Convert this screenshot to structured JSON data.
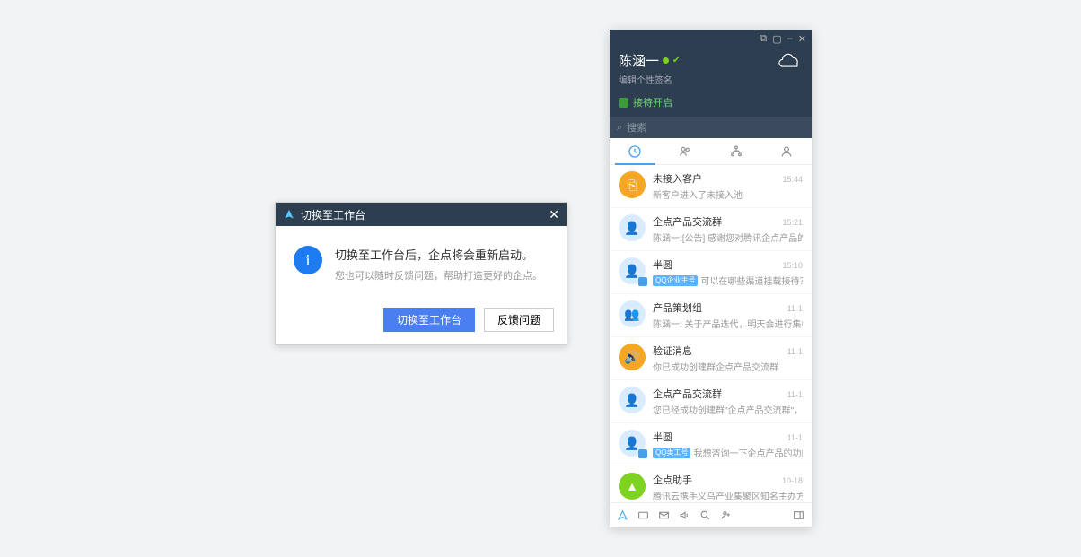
{
  "dialog": {
    "title": "切换至工作台",
    "message": "切换至工作台后，企点将会重新启动。",
    "sub": "您也可以随时反馈问题，帮助打造更好的企点。",
    "primary_btn": "切换至工作台",
    "secondary_btn": "反馈问题"
  },
  "window": {
    "username": "陈涵一",
    "signature": "编辑个性签名",
    "status_text": "接待开启",
    "search_placeholder": "搜索",
    "conversations": [
      {
        "avatar": "orange",
        "avatar_glyph": "⎘",
        "title": "未接入客户",
        "time": "15:44",
        "sub": "新客户进入了未接入池",
        "badge": ""
      },
      {
        "avatar": "blue",
        "avatar_glyph": "👤",
        "title": "企点产品交流群",
        "time": "15:21",
        "sub": "陈涵一:[公告] 感谢您对腾讯企点产品的支持",
        "badge": ""
      },
      {
        "avatar": "blue",
        "avatar_glyph": "👤",
        "title": "半圆",
        "time": "15:10",
        "sub": "可以在哪些渠道挂载接待？",
        "badge": "QQ企业主号",
        "corner": true
      },
      {
        "avatar": "blue",
        "avatar_glyph": "👥",
        "title": "产品策划组",
        "time": "11-1",
        "sub": "陈涵一: 关于产品迭代，明天会进行集中的培",
        "badge": ""
      },
      {
        "avatar": "speaker",
        "avatar_glyph": "🔊",
        "title": "验证消息",
        "time": "11-1",
        "sub": "你已成功创建群企点产品交流群",
        "badge": ""
      },
      {
        "avatar": "blue",
        "avatar_glyph": "👤",
        "title": "企点产品交流群",
        "time": "11-1",
        "sub": "您已经成功创建群\"企点产品交流群\"，马上",
        "badge": ""
      },
      {
        "avatar": "blue",
        "avatar_glyph": "👤",
        "title": "半圆",
        "time": "11-1",
        "sub": "我想咨询一下企点产品的功能",
        "badge": "QQ类工号",
        "corner": true
      },
      {
        "avatar": "green",
        "avatar_glyph": "▲",
        "title": "企点助手",
        "time": "10-18",
        "sub": "腾讯云携手义乌产业集聚区知名主办方举办",
        "badge": ""
      }
    ]
  }
}
